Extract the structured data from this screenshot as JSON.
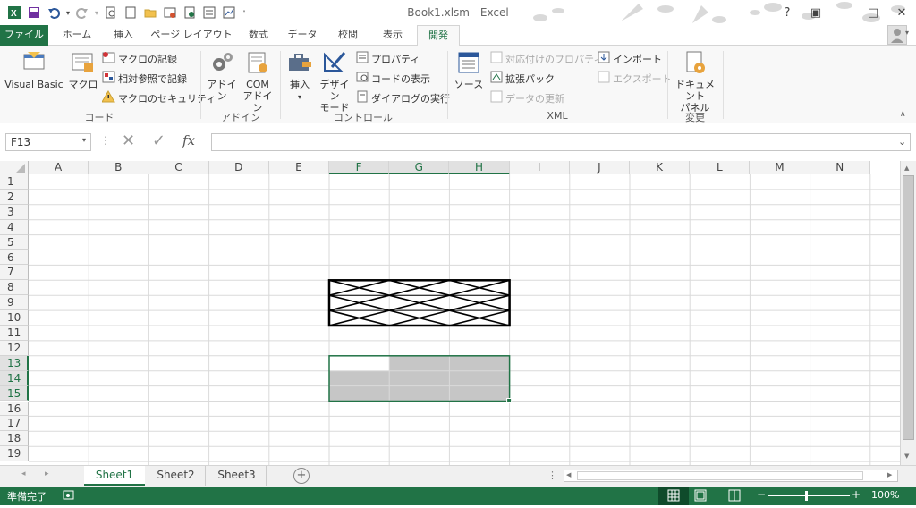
{
  "window": {
    "title": "Book1.xlsm - Excel"
  },
  "qat": {
    "save": "save-icon",
    "undo": "undo-icon",
    "redo": "redo-icon"
  },
  "tabs": [
    {
      "label": "ファイル"
    },
    {
      "label": "ホーム"
    },
    {
      "label": "挿入"
    },
    {
      "label": "ページ レイアウト"
    },
    {
      "label": "数式"
    },
    {
      "label": "データ"
    },
    {
      "label": "校閲"
    },
    {
      "label": "表示"
    },
    {
      "label": "開発"
    }
  ],
  "ribbon": {
    "code": {
      "label": "コード",
      "visual_basic": "Visual Basic",
      "macro": "マクロ",
      "record": "マクロの記録",
      "relative": "相対参照で記録",
      "security": "マクロのセキュリティ"
    },
    "addin": {
      "label": "アドイン",
      "addin": "アドイン",
      "com1": "COM",
      "com2": "アドイン"
    },
    "controls": {
      "label": "コントロール",
      "insert": "挿入",
      "design1": "デザイン",
      "design2": "モード",
      "properties": "プロパティ",
      "view_code": "コードの表示",
      "dialog": "ダイアログの実行"
    },
    "xml": {
      "label": "XML",
      "source": "ソース",
      "map_props": "対応付けのプロパティ",
      "expansion": "拡張パック",
      "refresh": "データの更新",
      "import": "インポート",
      "export": "エクスポート"
    },
    "modify": {
      "label": "変更",
      "doc1": "ドキュメント",
      "doc2": "パネル"
    }
  },
  "formula_bar": {
    "name_box": "F13",
    "fx": "fx",
    "content": ""
  },
  "columns": [
    "A",
    "B",
    "C",
    "D",
    "E",
    "F",
    "G",
    "H",
    "I",
    "J",
    "K",
    "L",
    "M",
    "N"
  ],
  "rows": [
    "1",
    "2",
    "3",
    "4",
    "5",
    "6",
    "7",
    "8",
    "9",
    "10",
    "11",
    "12",
    "13",
    "14",
    "15",
    "16",
    "17",
    "18",
    "19"
  ],
  "sheets": [
    {
      "label": "Sheet1"
    },
    {
      "label": "Sheet2"
    },
    {
      "label": "Sheet3"
    }
  ],
  "status": {
    "ready": "準備完了",
    "zoom": "100%"
  },
  "colors": {
    "accent": "#217346",
    "selection": "#c6c6c6"
  }
}
